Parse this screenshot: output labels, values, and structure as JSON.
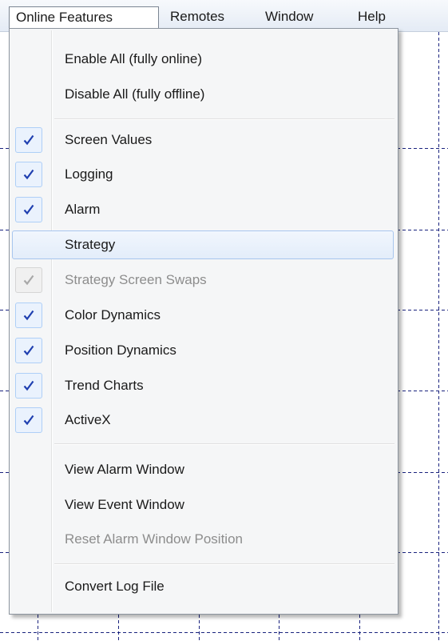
{
  "menubar": {
    "items": [
      {
        "label": "Online Features"
      },
      {
        "label": "Remotes"
      },
      {
        "label": "Window"
      },
      {
        "label": "Help"
      }
    ]
  },
  "dropdown": {
    "items": [
      {
        "label": "Enable All (fully online)",
        "checked": false,
        "enabled": true
      },
      {
        "label": "Disable All (fully offline)",
        "checked": false,
        "enabled": true
      },
      {
        "label": "Screen Values",
        "checked": true,
        "enabled": true
      },
      {
        "label": "Logging",
        "checked": true,
        "enabled": true
      },
      {
        "label": "Alarm",
        "checked": true,
        "enabled": true
      },
      {
        "label": "Strategy",
        "checked": false,
        "enabled": true,
        "highlighted": true
      },
      {
        "label": "Strategy Screen Swaps",
        "checked": true,
        "enabled": false
      },
      {
        "label": "Color Dynamics",
        "checked": true,
        "enabled": true
      },
      {
        "label": "Position Dynamics",
        "checked": true,
        "enabled": true
      },
      {
        "label": "Trend Charts",
        "checked": true,
        "enabled": true
      },
      {
        "label": "ActiveX",
        "checked": true,
        "enabled": true
      },
      {
        "label": "View Alarm Window",
        "checked": false,
        "enabled": true
      },
      {
        "label": "View Event Window",
        "checked": false,
        "enabled": true
      },
      {
        "label": "Reset Alarm Window Position",
        "checked": false,
        "enabled": false
      },
      {
        "label": "Convert Log File",
        "checked": false,
        "enabled": true
      }
    ]
  },
  "colors": {
    "checkmark": "#1f3fb0",
    "checkmark_disabled": "#a8a8a8",
    "grid_line": "#1a237e",
    "disabled_text": "#8d8d8d"
  },
  "icons": {
    "check": "checkmark-icon"
  }
}
